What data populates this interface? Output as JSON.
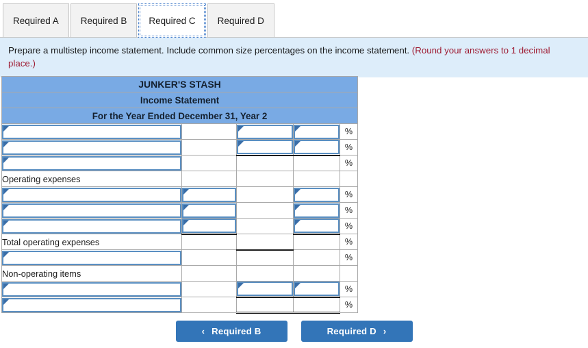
{
  "tabs": [
    {
      "label": "Required A",
      "active": false
    },
    {
      "label": "Required B",
      "active": false
    },
    {
      "label": "Required C",
      "active": true
    },
    {
      "label": "Required D",
      "active": false
    }
  ],
  "instructions": {
    "main": "Prepare a multistep income statement. Include common size percentages on the income statement. ",
    "hint": "(Round your answers to 1 decimal place.)"
  },
  "statement": {
    "company": "JUNKER'S STASH",
    "title": "Income Statement",
    "period": "For the Year Ended December 31, Year 2",
    "percent_symbol": "%",
    "rows": [
      {
        "label": "",
        "label_input": true,
        "c2": "none",
        "c3": "input",
        "c4": "input",
        "pct": true,
        "rule": ""
      },
      {
        "label": "",
        "label_input": true,
        "c2": "none",
        "c3": "input",
        "c4": "input",
        "pct": true,
        "rule": "under34"
      },
      {
        "label": "",
        "label_input": true,
        "c2": "none",
        "c3": "none",
        "c4": "none",
        "pct": true,
        "rule": ""
      },
      {
        "label": "Operating expenses",
        "label_input": false,
        "c2": "none",
        "c3": "none",
        "c4": "none",
        "pct": false,
        "rule": ""
      },
      {
        "label": "",
        "label_input": true,
        "c2": "input",
        "c3": "none",
        "c4": "input",
        "pct": true,
        "rule": ""
      },
      {
        "label": "",
        "label_input": true,
        "c2": "input",
        "c3": "none",
        "c4": "input",
        "pct": true,
        "rule": ""
      },
      {
        "label": "",
        "label_input": true,
        "c2": "input",
        "c3": "none",
        "c4": "input",
        "pct": true,
        "rule": "under24"
      },
      {
        "label": "Total operating expenses",
        "label_input": false,
        "c2": "none",
        "c3": "none",
        "c4": "none",
        "pct": true,
        "rule": "under3"
      },
      {
        "label": "",
        "label_input": true,
        "c2": "none",
        "c3": "none",
        "c4": "none",
        "pct": true,
        "rule": ""
      },
      {
        "label": "Non-operating items",
        "label_input": false,
        "c2": "none",
        "c3": "none",
        "c4": "none",
        "pct": false,
        "rule": ""
      },
      {
        "label": "",
        "label_input": true,
        "c2": "none",
        "c3": "input",
        "c4": "input",
        "pct": true,
        "rule": "under34"
      },
      {
        "label": "",
        "label_input": true,
        "c2": "none",
        "c3": "none",
        "c4": "none",
        "pct": true,
        "rule": "double34"
      }
    ]
  },
  "navigation": {
    "prev_label": "Required B",
    "prev_icon": "chevron-left-icon",
    "prev_chevron": "‹",
    "next_label": "Required D",
    "next_icon": "chevron-right-icon",
    "next_chevron": "›"
  },
  "colors": {
    "header_blue": "#79aae4",
    "banner_blue": "#ddedfa",
    "hint_red": "#9e1b32",
    "button_blue": "#3375b8",
    "input_border": "#5a8fc2",
    "marker_blue": "#3a6ea8"
  }
}
